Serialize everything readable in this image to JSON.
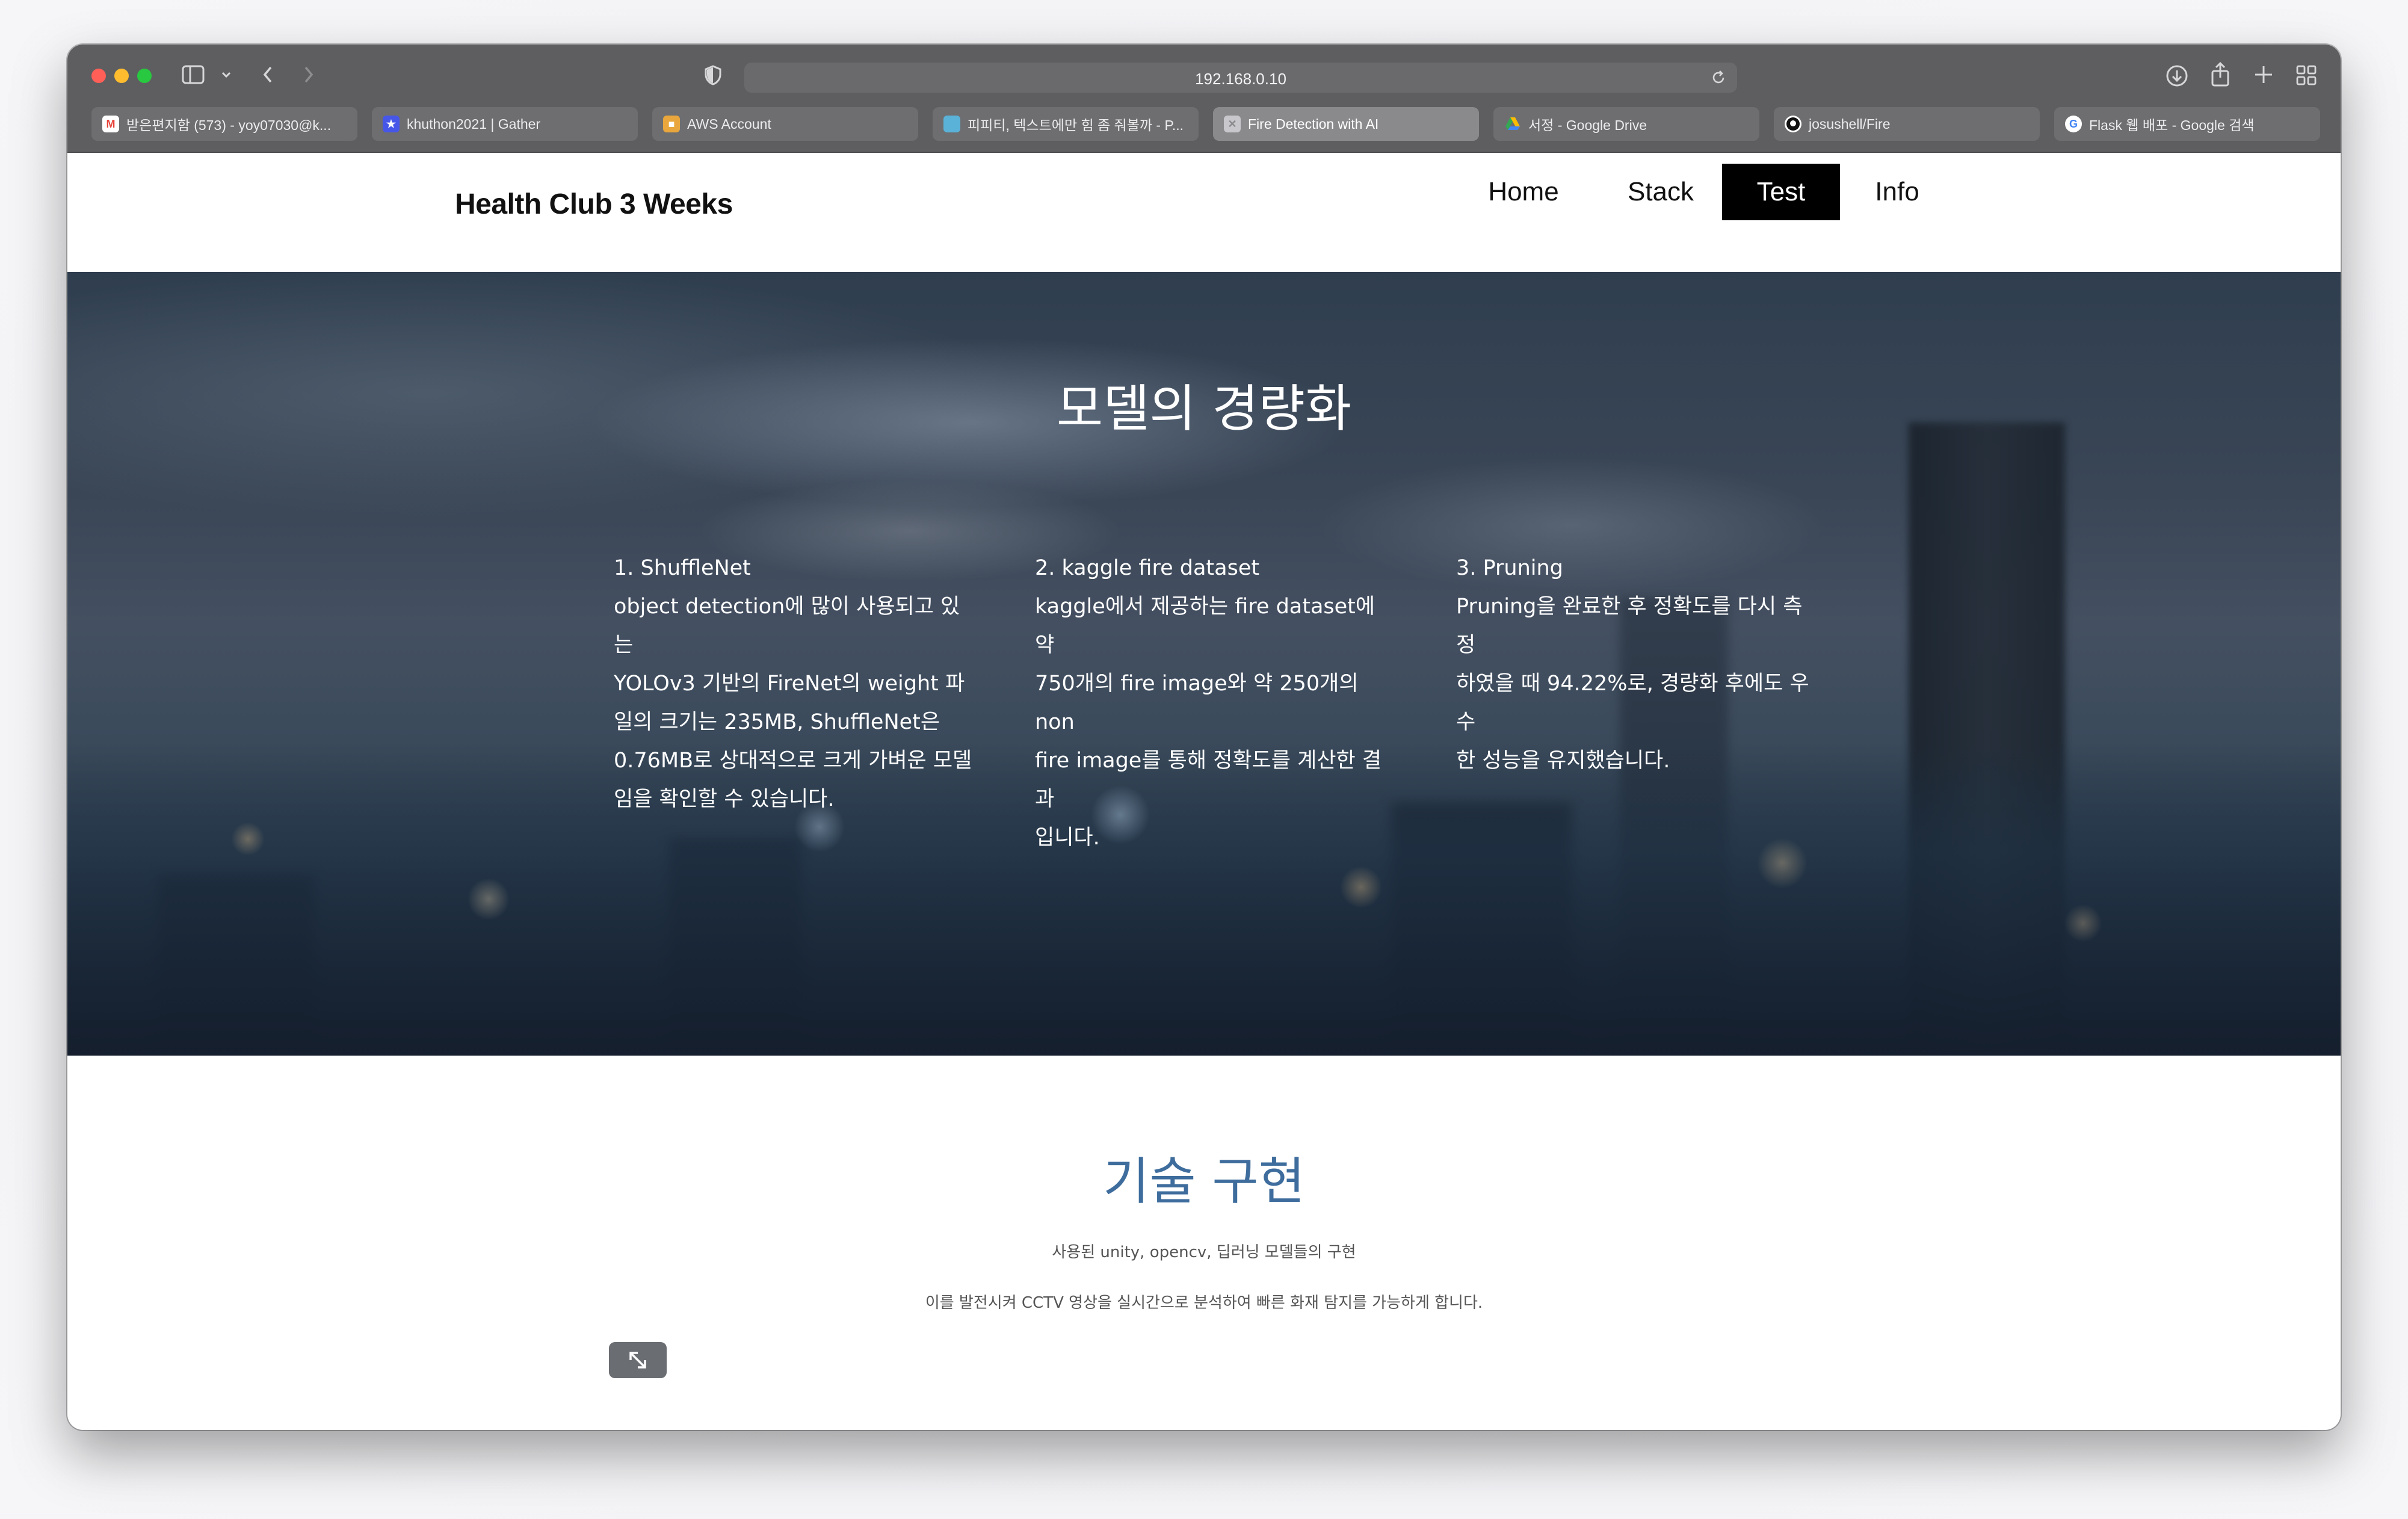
{
  "browser": {
    "url": "192.168.0.10",
    "tabs": [
      {
        "label": "받은편지함 (573) - yoy07030@k...",
        "favicon": "gmail-icon",
        "color": "#e8453c",
        "active": false
      },
      {
        "label": "khuthon2021 | Gather",
        "favicon": "gather-icon",
        "color": "#4656e8",
        "active": false
      },
      {
        "label": "AWS Account",
        "favicon": "aws-icon",
        "color": "#e8a63c",
        "active": false
      },
      {
        "label": "피피티, 텍스트에만 힘 좀 줘볼까 - P...",
        "favicon": "page-icon",
        "color": "#5bb2d9",
        "active": false
      },
      {
        "label": "Fire Detection with AI",
        "favicon": "page-icon",
        "color": "#c8c8cc",
        "active": true
      },
      {
        "label": "서정 - Google Drive",
        "favicon": "google-drive-icon",
        "color": "#34a853",
        "active": false
      },
      {
        "label": "josushell/Fire",
        "favicon": "github-icon",
        "color": "#ffffff",
        "active": false
      },
      {
        "label": "Flask 웹 배포 - Google 검색",
        "favicon": "google-icon",
        "color": "#ffffff",
        "active": false
      }
    ]
  },
  "site": {
    "brand": "Health Club 3 Weeks",
    "nav": [
      {
        "label": "Home",
        "active": false
      },
      {
        "label": "Stack",
        "active": false
      },
      {
        "label": "Test",
        "active": true
      },
      {
        "label": "Info",
        "active": false
      }
    ]
  },
  "hero": {
    "title": "모델의 경량화",
    "columns": [
      {
        "heading": "1. ShuffleNet",
        "lines": [
          "object detection에 많이 사용되고 있는",
          "YOLOv3 기반의 FireNet의 weight 파",
          "일의 크기는 235MB, ShuffleNet은",
          "0.76MB로 상대적으로 크게 가벼운 모델",
          "임을 확인할 수 있습니다."
        ]
      },
      {
        "heading": "2. kaggle fire dataset",
        "lines": [
          "kaggle에서 제공하는 fire dataset에 약",
          "750개의 fire image와 약 250개의 non",
          "fire image를 통해 정확도를 계산한 결과",
          "입니다."
        ]
      },
      {
        "heading": "3. Pruning",
        "lines": [
          "Pruning을 완료한 후 정확도를 다시 측정",
          "하였을 때 94.22%로, 경량화 후에도 우수",
          "한 성능을 유지했습니다."
        ]
      }
    ]
  },
  "tech": {
    "title": "기술 구현",
    "subtitle1": "사용된 unity, opencv, 딥러닝 모델들의 구현",
    "subtitle2": "이를 발전시켜 CCTV 영상을 실시간으로 분석하여 빠른 화재 탐지를 가능하게 합니다."
  }
}
